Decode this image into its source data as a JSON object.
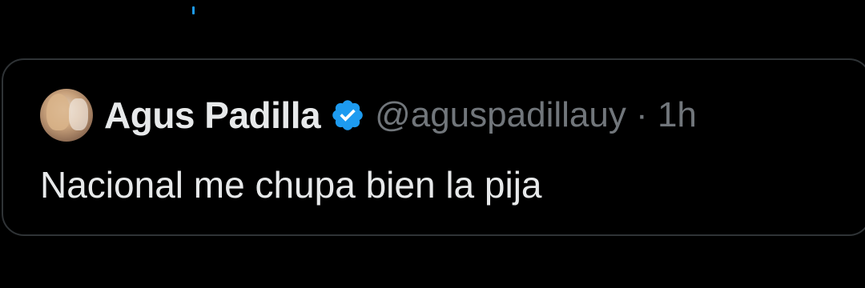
{
  "quote": {
    "author": {
      "display_name": "Agus Padilla",
      "handle_time": "@aguspadillauy · 1h",
      "verified": true,
      "avatar": "profile-photo"
    },
    "text": "Nacional me chupa bien la pija"
  },
  "colors": {
    "background": "#000000",
    "border": "#2f3336",
    "primary_text": "#e7e9ea",
    "secondary_text": "#71767b",
    "verified_badge": "#1d9bf0"
  },
  "icons": {
    "verified": "verified-badge-icon"
  }
}
